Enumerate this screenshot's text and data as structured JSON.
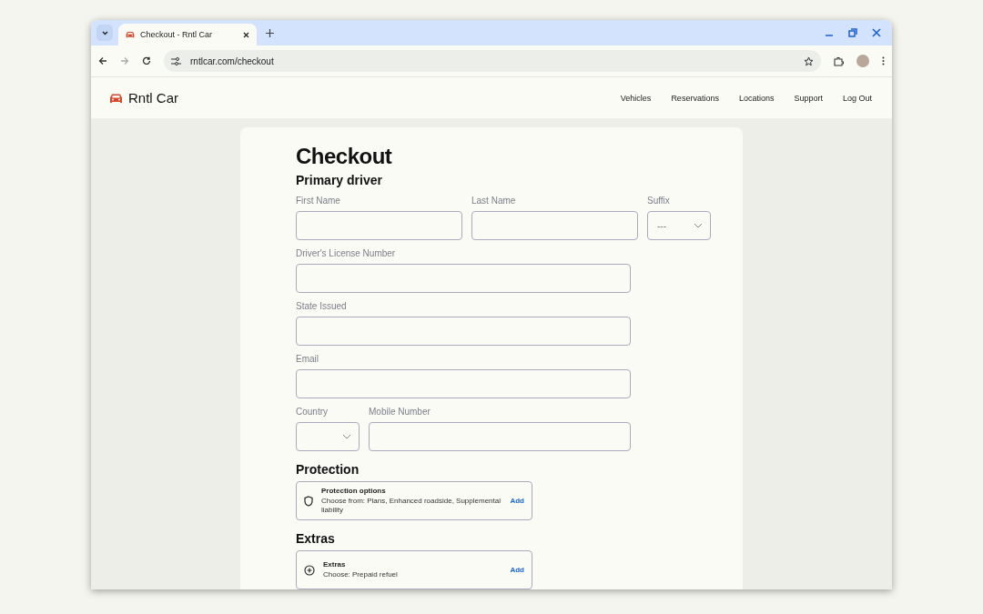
{
  "browser": {
    "tab_title": "Checkout - Rntl Car",
    "url": "rntlcar.com/checkout"
  },
  "site": {
    "brand": "Rntl Car",
    "nav": [
      "Vehicles",
      "Reservations",
      "Locations",
      "Support",
      "Log Out"
    ]
  },
  "checkout": {
    "title": "Checkout",
    "section": "Primary driver",
    "rows": [
      {
        "fields": [
          {
            "label": "First Name",
            "kind": "text"
          },
          {
            "label": "Last Name",
            "kind": "text"
          },
          {
            "label": "Suffix",
            "kind": "select",
            "value": "---"
          }
        ]
      },
      {
        "fields": [
          {
            "label": "Driver's License Number",
            "kind": "text"
          }
        ]
      },
      {
        "fields": [
          {
            "label": "State Issued",
            "kind": "text"
          }
        ]
      },
      {
        "fields": [
          {
            "label": "Email",
            "kind": "text"
          }
        ]
      },
      {
        "fields": [
          {
            "label": "Country",
            "kind": "select"
          },
          {
            "label": "Mobile Number",
            "kind": "text"
          }
        ]
      }
    ],
    "options": [
      {
        "heading": "Protection",
        "kind": "shield",
        "title": "Protection options",
        "description": "Choose from: Plans, Enhanced roadside, Supplemental liability",
        "action": "Add"
      },
      {
        "heading": "Extras",
        "kind": "plus",
        "title": "Extras",
        "description": "Choose: Prepaid refuel",
        "action": "Add"
      }
    ]
  }
}
